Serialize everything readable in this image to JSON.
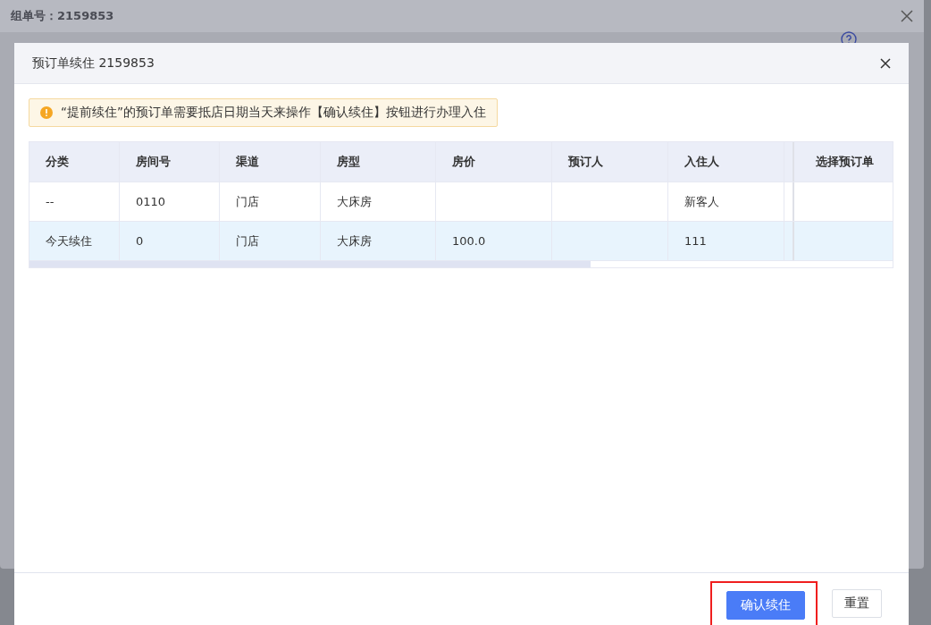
{
  "outer_dialog": {
    "title": "组单号：2159853"
  },
  "modal": {
    "title": "预订单续住 2159853",
    "alert": "“提前续住”的预订单需要抵店日期当天来操作【确认续住】按钮进行办理入住",
    "table": {
      "columns": [
        "分类",
        "房间号",
        "渠道",
        "房型",
        "房价",
        "预订人",
        "入住人",
        "选择预订单"
      ],
      "rows": [
        {
          "cells": [
            "--",
            "0110",
            "门店",
            "大床房",
            "",
            "",
            "新客人",
            ""
          ],
          "selected": false
        },
        {
          "cells": [
            "今天续住",
            "0",
            "门店",
            "大床房",
            "100.0",
            "",
            "111",
            ""
          ],
          "selected": true
        }
      ]
    },
    "buttons": [
      {
        "label": "确认续住",
        "kind": "primary",
        "highlighted": true
      },
      {
        "label": "重置",
        "kind": "default",
        "highlighted": false
      }
    ]
  }
}
